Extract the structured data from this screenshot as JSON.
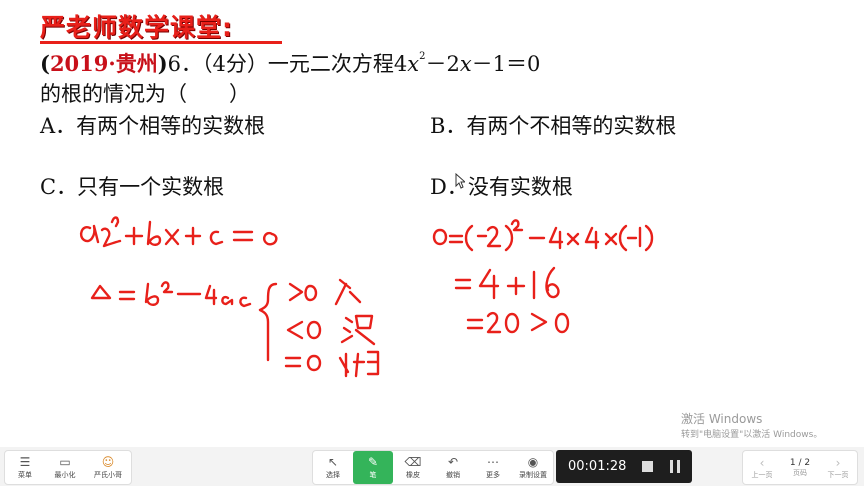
{
  "lesson": {
    "title": "严老师数学课堂:",
    "year_tag_open": "(",
    "year": "2019",
    "region": "·贵州",
    "year_tag_close": ")",
    "question_prefix": "6．（4分）一元二次方程4",
    "equation_var1": "x",
    "exponent": "2",
    "equation_mid": "－2",
    "equation_var2": "x",
    "equation_end": "－1＝0",
    "question_line2": "的根的情况为（　　）",
    "option_a": "A．有两个相等的实数根",
    "option_b": "B．有两个不相等的实数根",
    "option_c": "C．只有一个实数根",
    "option_d": "D．没有实数根"
  },
  "handwriting": {
    "color": "#e8201a",
    "general_form": "ax²+bx+c=0",
    "discriminant": "Δ=b²−4ac",
    "case_gt": ">0 不",
    "case_lt": "<0 没",
    "case_eq": "=0 相",
    "calc_line1": "Δ=(−2)²−4×4×(−1)",
    "calc_line2": "=4+16",
    "calc_line3": "=20>0"
  },
  "watermark": {
    "line1": "激活 Windows",
    "line2": "转到\"电脑设置\"以激活 Windows。"
  },
  "toolbar": {
    "left": [
      {
        "icon": "menu-icon",
        "glyph": "☰",
        "label": "菜单"
      },
      {
        "icon": "minimize-icon",
        "glyph": "▭",
        "label": "最小化"
      },
      {
        "icon": "avatar-icon",
        "glyph": "☺",
        "label": "严氏小哥"
      }
    ],
    "tools": [
      {
        "icon": "select-icon",
        "glyph": "↖",
        "label": "选择"
      },
      {
        "icon": "pen-icon",
        "glyph": "✎",
        "label": "笔"
      },
      {
        "icon": "eraser-icon",
        "glyph": "⌫",
        "label": "橡皮"
      },
      {
        "icon": "undo-icon",
        "glyph": "↶",
        "label": "撤销"
      },
      {
        "icon": "more-icon",
        "glyph": "⋯",
        "label": "更多"
      },
      {
        "icon": "record-settings-icon",
        "glyph": "◉",
        "label": "录制设置"
      }
    ],
    "active_tool": "笔",
    "timer": "00:01:28",
    "page_prev": "上一页",
    "page_current": "1 / 2",
    "page_label": "页码",
    "page_next": "下一页"
  }
}
